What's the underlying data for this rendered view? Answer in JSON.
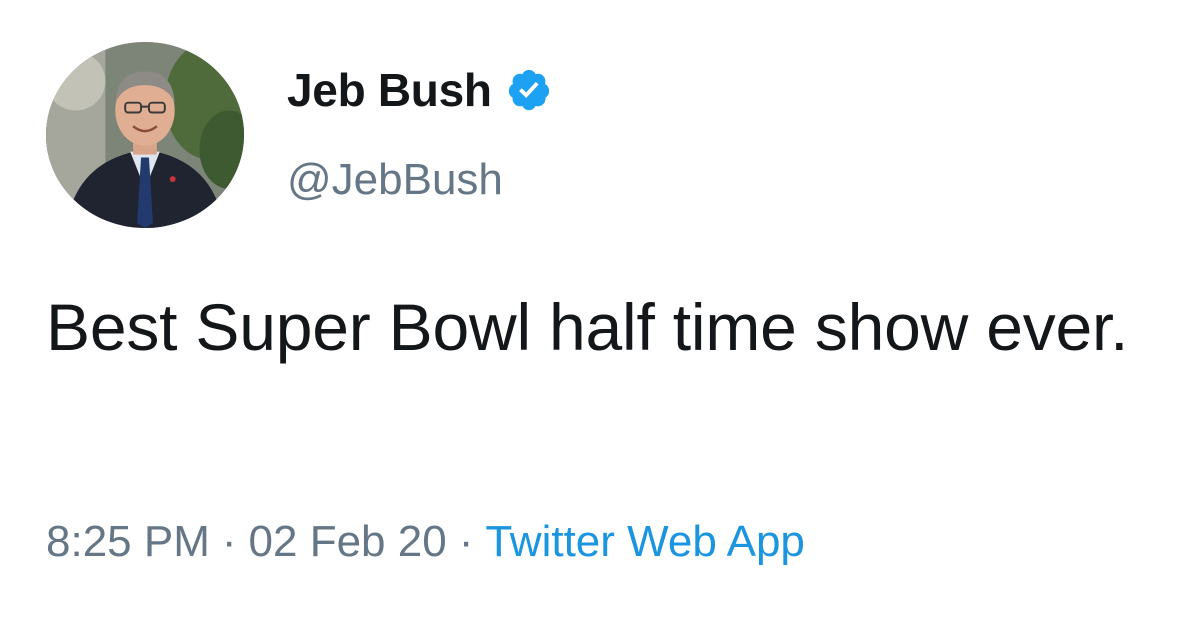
{
  "tweet": {
    "author": {
      "display_name": "Jeb Bush",
      "handle": "@JebBush",
      "verified": true,
      "avatar_icon": "profile-photo-icon"
    },
    "text": "Best Super Bowl half time show ever.",
    "time": "8:25 PM",
    "date": "02 Feb 20",
    "source": "Twitter Web App",
    "separator": "·"
  },
  "colors": {
    "text": "#14171a",
    "secondary": "#657786",
    "link": "#1b95e0",
    "verified_badge": "#1da1f2"
  }
}
